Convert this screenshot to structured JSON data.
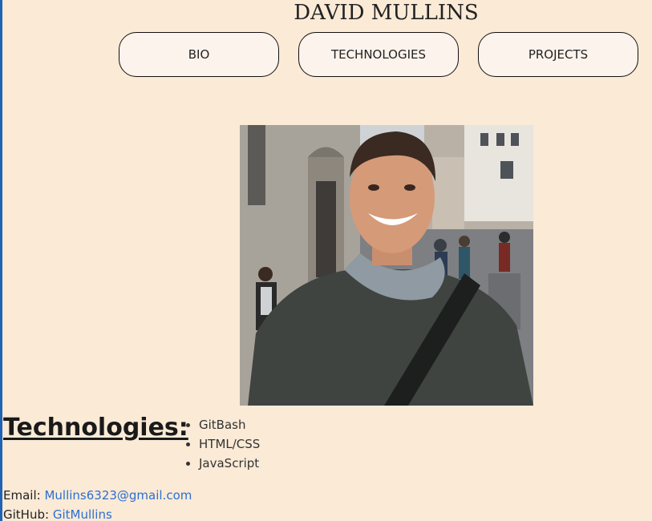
{
  "header": {
    "title": "DAVID MULLINS"
  },
  "nav": {
    "items": [
      {
        "label": "BIO"
      },
      {
        "label": "TECHNOLOGIES"
      },
      {
        "label": "PROJECTS"
      }
    ]
  },
  "profile": {
    "photo_alt": "Portrait photo"
  },
  "technologies": {
    "heading": "Technologies:",
    "items": [
      "GitBash",
      "HTML/CSS",
      "JavaScript"
    ]
  },
  "contact": {
    "email_label": "Email:",
    "email": "Mullins6323@gmail.com",
    "github_label": "GitHub:",
    "github": "GitMullins"
  },
  "colors": {
    "background": "#faead6",
    "button_bg": "#fcf3ec",
    "link": "#2c6fd1"
  }
}
